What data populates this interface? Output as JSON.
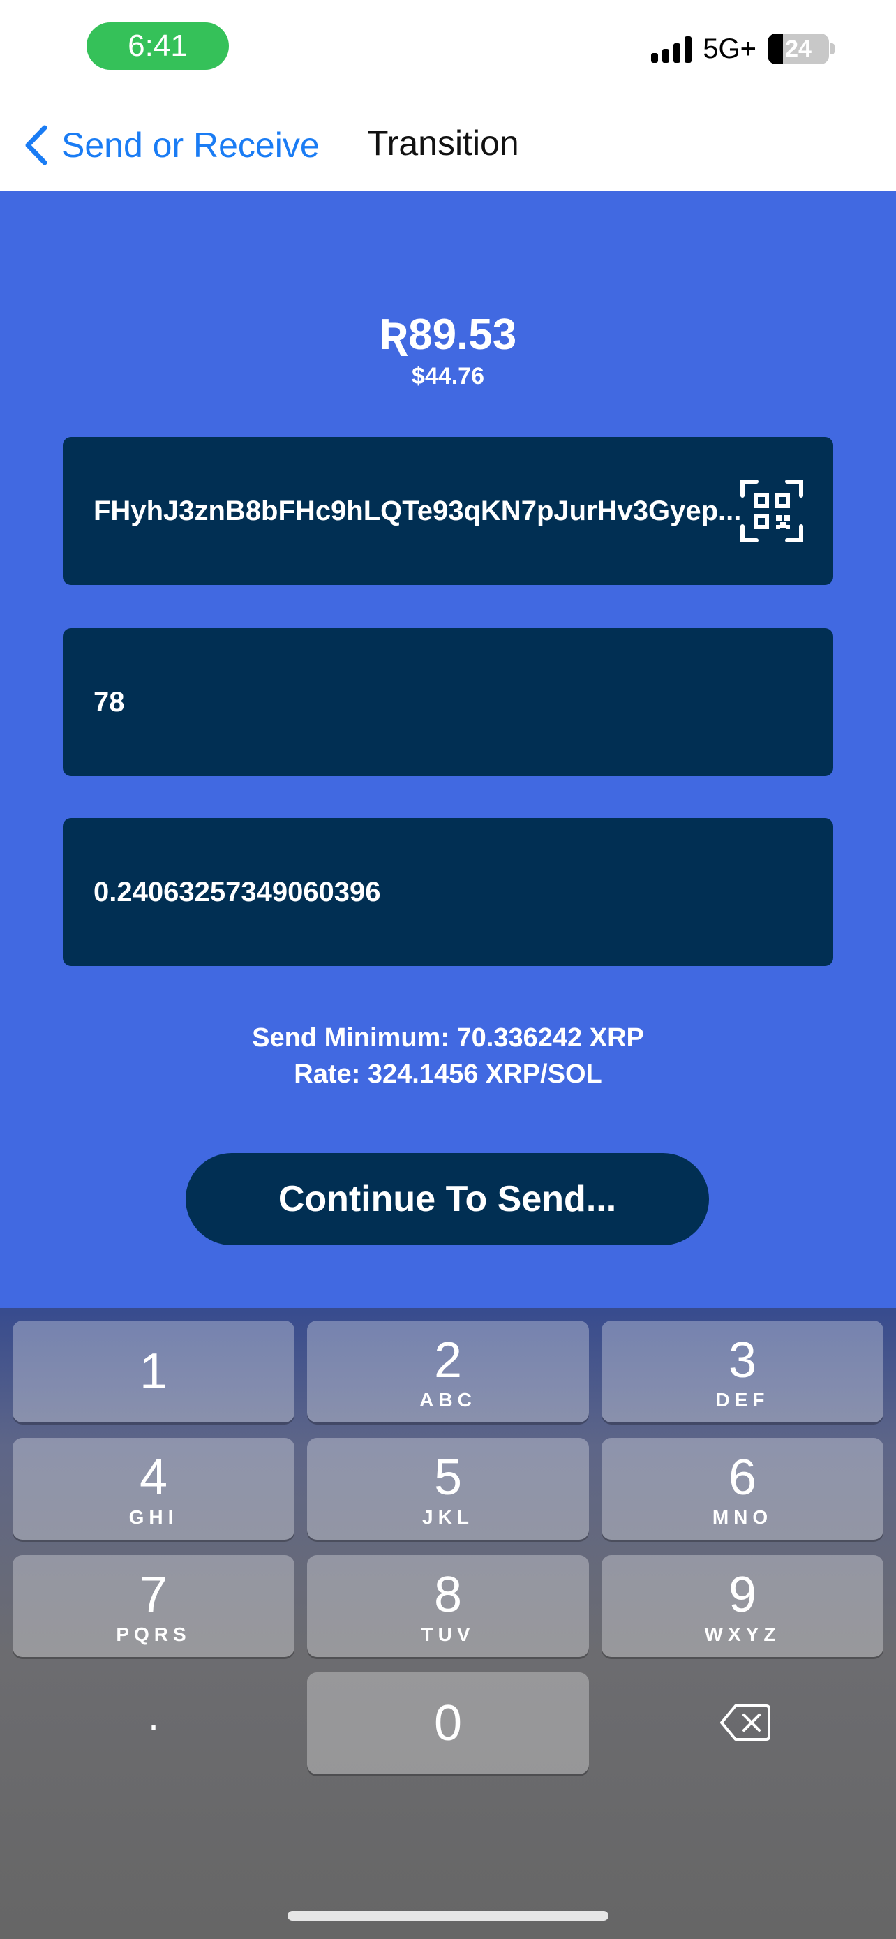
{
  "status_bar": {
    "time": "6:41",
    "network": "5G+",
    "battery": "24"
  },
  "nav": {
    "back_label": "Send or Receive",
    "title": "Transition"
  },
  "main": {
    "amount_primary": "Ʀ89.53",
    "amount_secondary": "$44.76",
    "address_value": "FHyhJ3znB8bFHc9hLQTe93qKN7pJurHv3Gyep...",
    "amount_value": "78",
    "converted_value": "0.24063257349060396",
    "send_minimum": "Send Minimum: 70.336242 XRP",
    "rate": "Rate: 324.1456 XRP/SOL",
    "continue_label": "Continue To Send..."
  },
  "keyboard": {
    "keys": [
      {
        "num": "1",
        "letters": ""
      },
      {
        "num": "2",
        "letters": "ABC"
      },
      {
        "num": "3",
        "letters": "DEF"
      },
      {
        "num": "4",
        "letters": "GHI"
      },
      {
        "num": "5",
        "letters": "JKL"
      },
      {
        "num": "6",
        "letters": "MNO"
      },
      {
        "num": "7",
        "letters": "PQRS"
      },
      {
        "num": "8",
        "letters": "TUV"
      },
      {
        "num": "9",
        "letters": "WXYZ"
      },
      {
        "num": "0",
        "letters": ""
      }
    ],
    "dot_label": ".",
    "delete_icon": "delete-backspace-icon"
  },
  "colors": {
    "background": "#4169e1",
    "field": "#012f53",
    "accent_link": "#1a7cf4",
    "time_pill": "#35c159"
  }
}
